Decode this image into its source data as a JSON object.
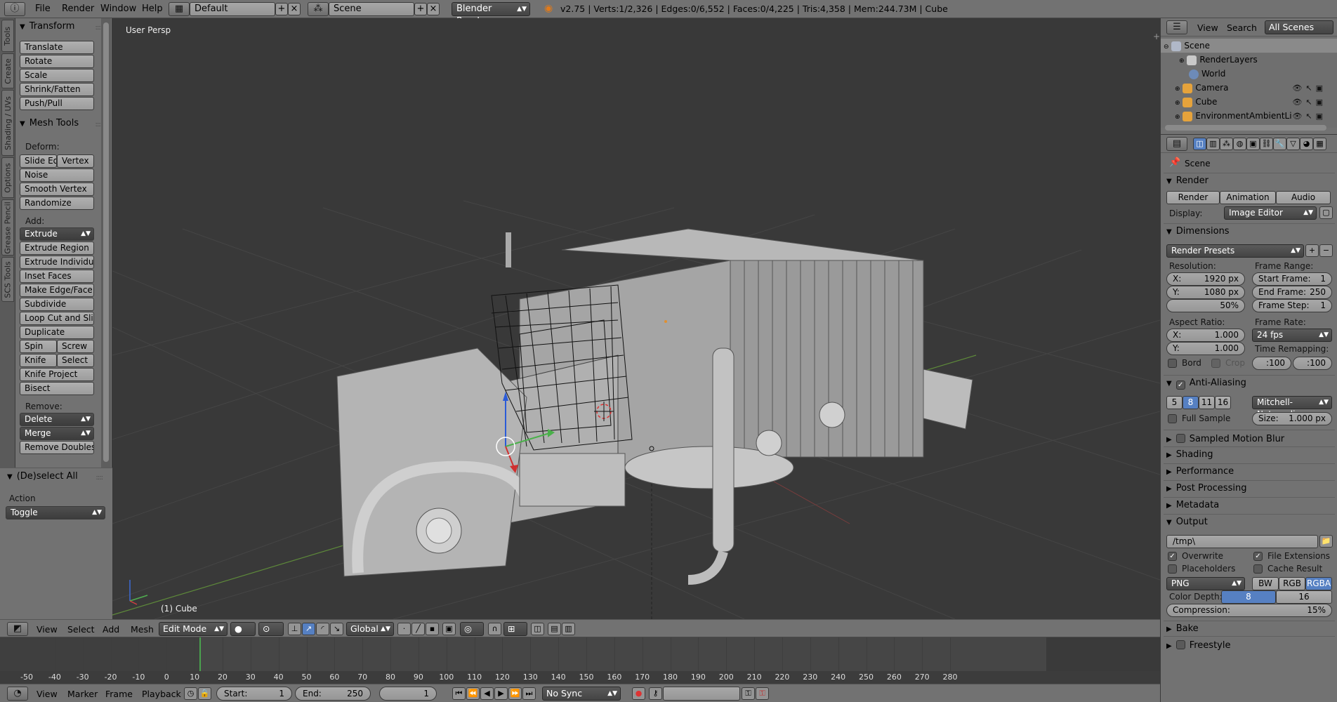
{
  "topbar": {
    "menus": [
      "File",
      "Render",
      "Window",
      "Help"
    ],
    "layout": "Default",
    "scene": "Scene",
    "engine": "Blender Render",
    "stats": "v2.75 | Verts:1/2,326 | Edges:0/6,552 | Faces:0/4,225 | Tris:4,358 | Mem:244.73M | Cube"
  },
  "tabs": [
    "Tools",
    "Create",
    "Shading / UVs",
    "Options",
    "Grease Pencil",
    "SCS Tools"
  ],
  "toolshelf": {
    "transform": {
      "title": "Transform",
      "buttons": [
        "Translate",
        "Rotate",
        "Scale",
        "Shrink/Fatten",
        "Push/Pull"
      ]
    },
    "mesh_tools": {
      "title": "Mesh Tools",
      "deform_label": "Deform:",
      "slide_edge": "Slide Ed",
      "vertex": "Vertex",
      "noise": "Noise",
      "smooth_vertex": "Smooth Vertex",
      "randomize": "Randomize",
      "add_label": "Add:",
      "extrude": "Extrude",
      "extrude_region": "Extrude Region",
      "extrude_individual": "Extrude Individual",
      "inset_faces": "Inset Faces",
      "make_edge_face": "Make Edge/Face",
      "subdivide": "Subdivide",
      "loop_cut": "Loop Cut and Slide",
      "duplicate": "Duplicate",
      "spin": "Spin",
      "screw": "Screw",
      "knife": "Knife",
      "select": "Select",
      "knife_project": "Knife Project",
      "bisect": "Bisect",
      "remove_label": "Remove:",
      "delete": "Delete",
      "merge": "Merge",
      "remove_doubles": "Remove Doubles"
    },
    "deselect": {
      "title": "(De)select All",
      "action_label": "Action",
      "action_value": "Toggle"
    }
  },
  "viewport": {
    "view_label": "User Persp",
    "object_label": "(1) Cube"
  },
  "view_header": {
    "menus": [
      "View",
      "Select",
      "Add",
      "Mesh"
    ],
    "mode": "Edit Mode",
    "orientation": "Global"
  },
  "timeline": {
    "ticks": [
      "-50",
      "-40",
      "-30",
      "-20",
      "-10",
      "0",
      "10",
      "20",
      "30",
      "40",
      "50",
      "60",
      "70",
      "80",
      "90",
      "100",
      "110",
      "120",
      "130",
      "140",
      "150",
      "160",
      "170",
      "180",
      "190",
      "200",
      "210",
      "220",
      "230",
      "240",
      "250",
      "260",
      "270",
      "280"
    ],
    "current_frame": 1
  },
  "timeline_header": {
    "menus": [
      "View",
      "Marker",
      "Frame",
      "Playback"
    ],
    "start_label": "Start:",
    "start_value": "1",
    "end_label": "End:",
    "end_value": "250",
    "current": "1",
    "sync": "No Sync"
  },
  "outliner": {
    "menus": [
      "View",
      "Search"
    ],
    "filter": "All Scenes",
    "items": [
      {
        "label": "Scene",
        "color": "#b0b8c8"
      },
      {
        "label": "RenderLayers",
        "color": "#c9c9c9"
      },
      {
        "label": "World",
        "color": "#6d8bb8"
      },
      {
        "label": "Camera",
        "color": "#e6a33b"
      },
      {
        "label": "Cube",
        "color": "#e6a33b"
      },
      {
        "label": "EnvironmentAmbientLi",
        "color": "#e6a33b"
      }
    ]
  },
  "properties": {
    "context": "Scene",
    "render": {
      "title": "Render",
      "render_btn": "Render",
      "animation_btn": "Animation",
      "audio_btn": "Audio",
      "display_label": "Display:",
      "display_value": "Image Editor"
    },
    "dimensions": {
      "title": "Dimensions",
      "presets": "Render Presets",
      "resolution_label": "Resolution:",
      "res_x_label": "X:",
      "res_x": "1920 px",
      "res_y_label": "Y:",
      "res_y": "1080 px",
      "res_pct": "50%",
      "frame_range_label": "Frame Range:",
      "start_frame_label": "Start Frame:",
      "start_frame": "1",
      "end_frame_label": "End Frame:",
      "end_frame": "250",
      "frame_step_label": "Frame Step:",
      "frame_step": "1",
      "aspect_label": "Aspect Ratio:",
      "asp_x_label": "X:",
      "asp_x": "1.000",
      "asp_y_label": "Y:",
      "asp_y": "1.000",
      "frame_rate_label": "Frame Rate:",
      "frame_rate": "24 fps",
      "time_remap_label": "Time Remapping:",
      "remap_old": ":100",
      "remap_new": ":100",
      "bord": "Bord",
      "crop": "Crop"
    },
    "anti_aliasing": {
      "title": "Anti-Aliasing",
      "samples": [
        "5",
        "8",
        "11",
        "16"
      ],
      "filter": "Mitchell-Netravali",
      "full_sample": "Full Sample",
      "size_label": "Size:",
      "size": "1.000 px"
    },
    "collapsed": [
      "Sampled Motion Blur",
      "Shading",
      "Performance",
      "Post Processing",
      "Metadata"
    ],
    "output": {
      "title": "Output",
      "path": "/tmp\\",
      "overwrite": "Overwrite",
      "file_extensions": "File Extensions",
      "placeholders": "Placeholders",
      "cache_result": "Cache Result",
      "format": "PNG",
      "bw": "BW",
      "rgb": "RGB",
      "rgba": "RGBA",
      "color_depth_label": "Color Depth:",
      "depth_8": "8",
      "depth_16": "16",
      "compression_label": "Compression:",
      "compression": "15%"
    },
    "bake": "Bake",
    "freestyle": "Freestyle"
  }
}
